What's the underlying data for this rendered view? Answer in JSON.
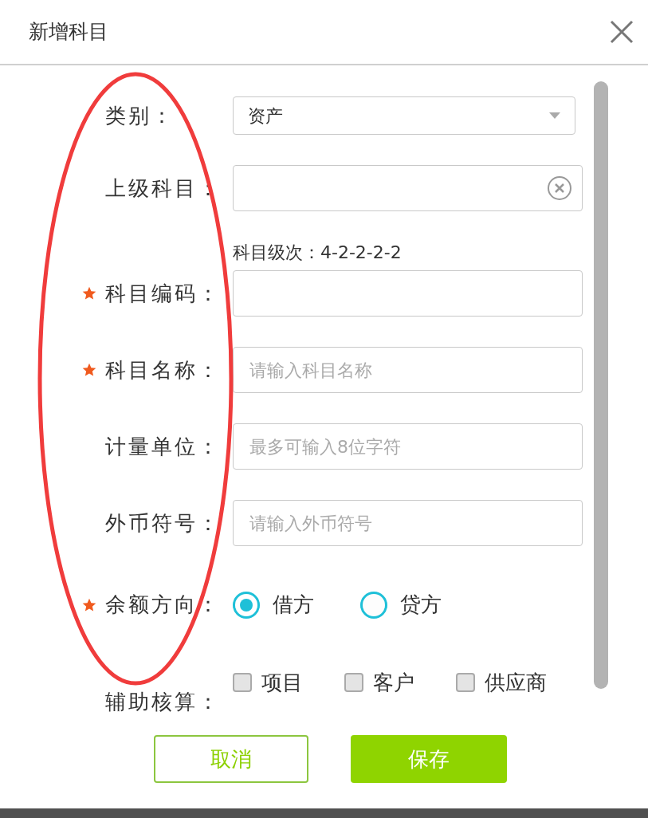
{
  "dialog": {
    "title": "新增科目"
  },
  "fields": [
    {
      "kind": "select",
      "label": "类别：",
      "required": false,
      "value": "资产"
    },
    {
      "kind": "clearable",
      "label": "上级科目：",
      "required": false
    },
    {
      "kind": "input",
      "label": "科目编码：",
      "required": true,
      "hint": "科目级次：4-2-2-2-2"
    },
    {
      "kind": "input",
      "label": "科目名称：",
      "required": true,
      "placeholder": "请输入科目名称"
    },
    {
      "kind": "input",
      "label": "计量单位：",
      "required": false,
      "placeholder": "最多可输入8位字符"
    },
    {
      "kind": "input",
      "label": "外币符号：",
      "required": false,
      "placeholder": "请输入外币符号"
    },
    {
      "kind": "radio",
      "label": "余额方向：",
      "required": true,
      "options": [
        {
          "label": "借方",
          "selected": true
        },
        {
          "label": "贷方",
          "selected": false
        }
      ]
    },
    {
      "kind": "checkboxes",
      "label": "辅助核算：",
      "required": false,
      "options": [
        {
          "label": "项目",
          "checked": false
        },
        {
          "label": "客户",
          "checked": false
        },
        {
          "label": "供应商",
          "checked": false
        }
      ]
    }
  ],
  "buttons": [
    {
      "kind": "secondary",
      "label": "取消"
    },
    {
      "kind": "primary",
      "label": "保存"
    }
  ]
}
